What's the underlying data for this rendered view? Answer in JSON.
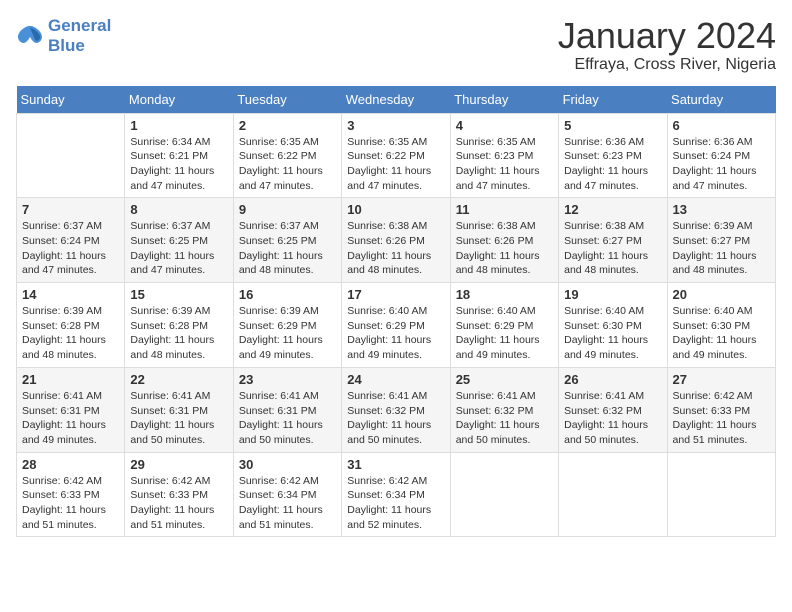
{
  "logo": {
    "line1": "General",
    "line2": "Blue"
  },
  "title": "January 2024",
  "subtitle": "Effraya, Cross River, Nigeria",
  "weekdays": [
    "Sunday",
    "Monday",
    "Tuesday",
    "Wednesday",
    "Thursday",
    "Friday",
    "Saturday"
  ],
  "weeks": [
    [
      {
        "day": "",
        "info": ""
      },
      {
        "day": "1",
        "info": "Sunrise: 6:34 AM\nSunset: 6:21 PM\nDaylight: 11 hours and 47 minutes."
      },
      {
        "day": "2",
        "info": "Sunrise: 6:35 AM\nSunset: 6:22 PM\nDaylight: 11 hours and 47 minutes."
      },
      {
        "day": "3",
        "info": "Sunrise: 6:35 AM\nSunset: 6:22 PM\nDaylight: 11 hours and 47 minutes."
      },
      {
        "day": "4",
        "info": "Sunrise: 6:35 AM\nSunset: 6:23 PM\nDaylight: 11 hours and 47 minutes."
      },
      {
        "day": "5",
        "info": "Sunrise: 6:36 AM\nSunset: 6:23 PM\nDaylight: 11 hours and 47 minutes."
      },
      {
        "day": "6",
        "info": "Sunrise: 6:36 AM\nSunset: 6:24 PM\nDaylight: 11 hours and 47 minutes."
      }
    ],
    [
      {
        "day": "7",
        "info": "Sunrise: 6:37 AM\nSunset: 6:24 PM\nDaylight: 11 hours and 47 minutes."
      },
      {
        "day": "8",
        "info": "Sunrise: 6:37 AM\nSunset: 6:25 PM\nDaylight: 11 hours and 47 minutes."
      },
      {
        "day": "9",
        "info": "Sunrise: 6:37 AM\nSunset: 6:25 PM\nDaylight: 11 hours and 48 minutes."
      },
      {
        "day": "10",
        "info": "Sunrise: 6:38 AM\nSunset: 6:26 PM\nDaylight: 11 hours and 48 minutes."
      },
      {
        "day": "11",
        "info": "Sunrise: 6:38 AM\nSunset: 6:26 PM\nDaylight: 11 hours and 48 minutes."
      },
      {
        "day": "12",
        "info": "Sunrise: 6:38 AM\nSunset: 6:27 PM\nDaylight: 11 hours and 48 minutes."
      },
      {
        "day": "13",
        "info": "Sunrise: 6:39 AM\nSunset: 6:27 PM\nDaylight: 11 hours and 48 minutes."
      }
    ],
    [
      {
        "day": "14",
        "info": "Sunrise: 6:39 AM\nSunset: 6:28 PM\nDaylight: 11 hours and 48 minutes."
      },
      {
        "day": "15",
        "info": "Sunrise: 6:39 AM\nSunset: 6:28 PM\nDaylight: 11 hours and 48 minutes."
      },
      {
        "day": "16",
        "info": "Sunrise: 6:39 AM\nSunset: 6:29 PM\nDaylight: 11 hours and 49 minutes."
      },
      {
        "day": "17",
        "info": "Sunrise: 6:40 AM\nSunset: 6:29 PM\nDaylight: 11 hours and 49 minutes."
      },
      {
        "day": "18",
        "info": "Sunrise: 6:40 AM\nSunset: 6:29 PM\nDaylight: 11 hours and 49 minutes."
      },
      {
        "day": "19",
        "info": "Sunrise: 6:40 AM\nSunset: 6:30 PM\nDaylight: 11 hours and 49 minutes."
      },
      {
        "day": "20",
        "info": "Sunrise: 6:40 AM\nSunset: 6:30 PM\nDaylight: 11 hours and 49 minutes."
      }
    ],
    [
      {
        "day": "21",
        "info": "Sunrise: 6:41 AM\nSunset: 6:31 PM\nDaylight: 11 hours and 49 minutes."
      },
      {
        "day": "22",
        "info": "Sunrise: 6:41 AM\nSunset: 6:31 PM\nDaylight: 11 hours and 50 minutes."
      },
      {
        "day": "23",
        "info": "Sunrise: 6:41 AM\nSunset: 6:31 PM\nDaylight: 11 hours and 50 minutes."
      },
      {
        "day": "24",
        "info": "Sunrise: 6:41 AM\nSunset: 6:32 PM\nDaylight: 11 hours and 50 minutes."
      },
      {
        "day": "25",
        "info": "Sunrise: 6:41 AM\nSunset: 6:32 PM\nDaylight: 11 hours and 50 minutes."
      },
      {
        "day": "26",
        "info": "Sunrise: 6:41 AM\nSunset: 6:32 PM\nDaylight: 11 hours and 50 minutes."
      },
      {
        "day": "27",
        "info": "Sunrise: 6:42 AM\nSunset: 6:33 PM\nDaylight: 11 hours and 51 minutes."
      }
    ],
    [
      {
        "day": "28",
        "info": "Sunrise: 6:42 AM\nSunset: 6:33 PM\nDaylight: 11 hours and 51 minutes."
      },
      {
        "day": "29",
        "info": "Sunrise: 6:42 AM\nSunset: 6:33 PM\nDaylight: 11 hours and 51 minutes."
      },
      {
        "day": "30",
        "info": "Sunrise: 6:42 AM\nSunset: 6:34 PM\nDaylight: 11 hours and 51 minutes."
      },
      {
        "day": "31",
        "info": "Sunrise: 6:42 AM\nSunset: 6:34 PM\nDaylight: 11 hours and 52 minutes."
      },
      {
        "day": "",
        "info": ""
      },
      {
        "day": "",
        "info": ""
      },
      {
        "day": "",
        "info": ""
      }
    ]
  ]
}
